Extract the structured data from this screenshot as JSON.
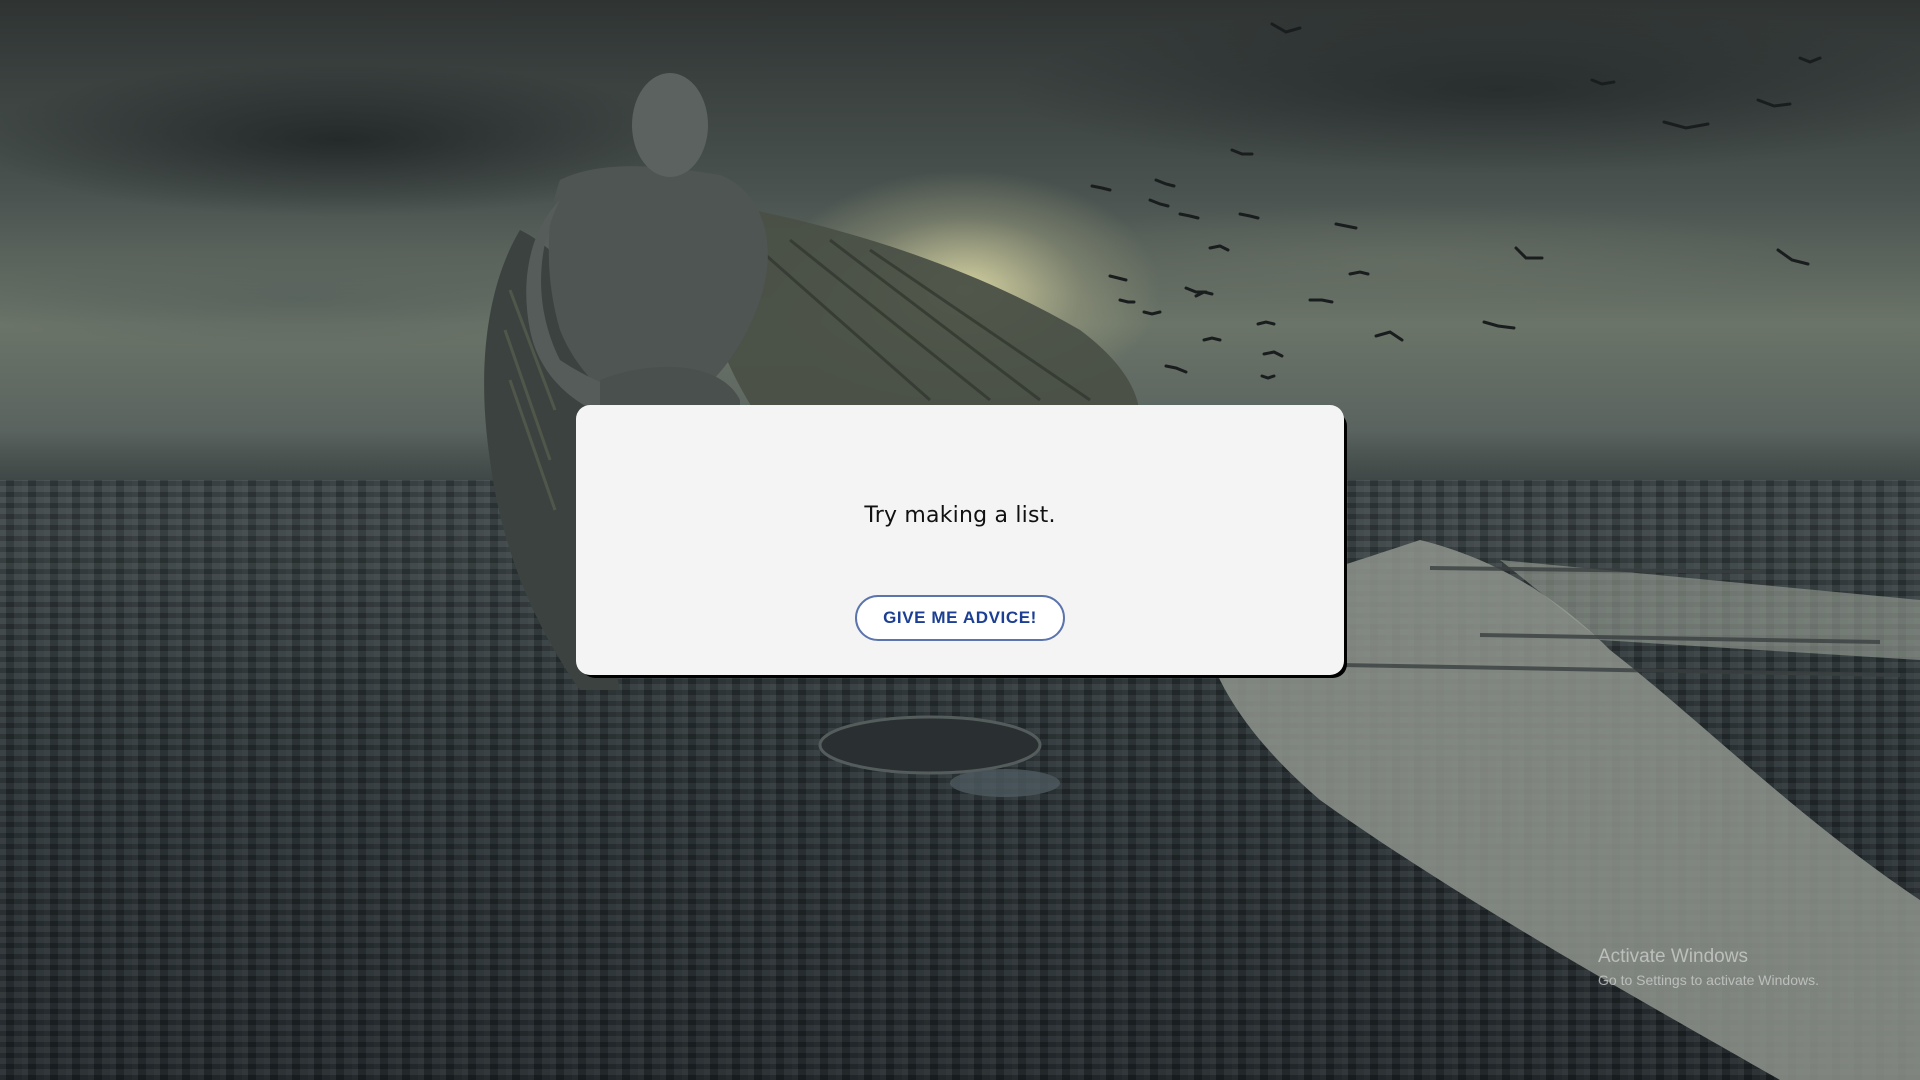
{
  "advice": {
    "text": "Try making a list.",
    "button_label": "GIVE ME ADVICE!"
  },
  "watermark": {
    "title": "Activate Windows",
    "subtitle": "Go to Settings to activate Windows."
  },
  "background": {
    "description_icon": "winged-statue-over-city-photo"
  },
  "colors": {
    "card_background": "#f4f4f4",
    "button_text": "#1c3f93",
    "button_border": "#5b74ad"
  }
}
